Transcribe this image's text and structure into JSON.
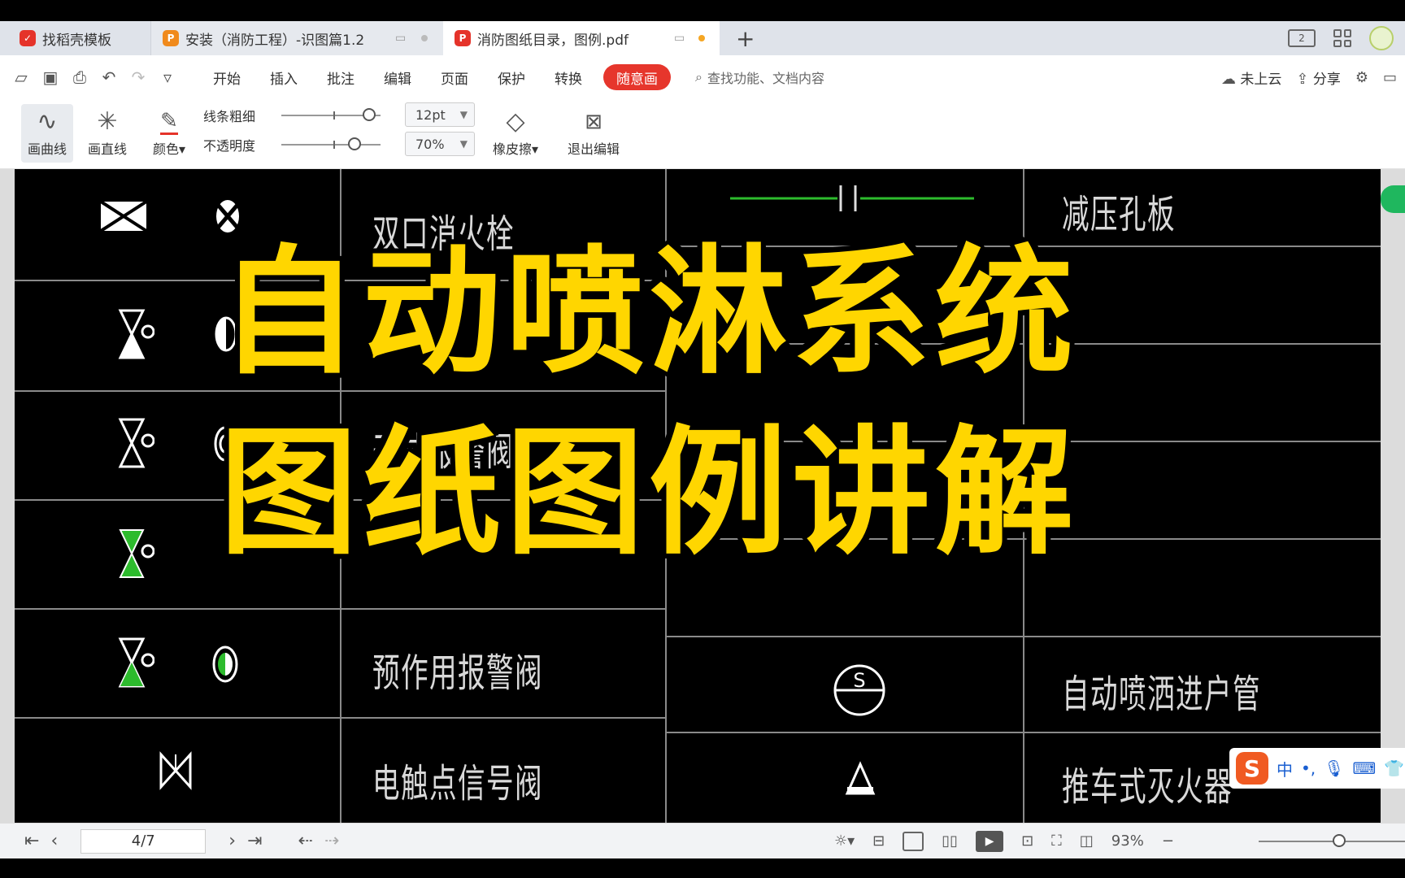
{
  "tabs": [
    {
      "label": "找稻壳模板",
      "icon": "docer-icon",
      "color": "#e5332a"
    },
    {
      "label": "安装（消防工程）-识图篇1.2",
      "icon": "ppt-icon",
      "color": "#f08a1c"
    },
    {
      "label": "消防图纸目录，图例.pdf",
      "icon": "pdf-icon",
      "color": "#e5332a"
    }
  ],
  "tabbar": {
    "window_btn": "2"
  },
  "menu": {
    "items": [
      "开始",
      "插入",
      "批注",
      "编辑",
      "页面",
      "保护",
      "转换"
    ],
    "active": "随意画",
    "search_placeholder": "查找功能、文档内容",
    "cloud": "未上云",
    "share": "分享"
  },
  "toolbar": {
    "curve": "画曲线",
    "line": "画直线",
    "color": "颜色",
    "thickness_label": "线条粗细",
    "thickness_value": "12pt",
    "opacity_label": "不透明度",
    "opacity_value": "70%",
    "eraser": "橡皮擦",
    "exit": "退出编辑"
  },
  "document": {
    "labels_left": [
      "双口消火栓",
      "干式报警阀",
      "预作用报警阀",
      "电触点信号阀"
    ],
    "labels_right": [
      "减压孔板",
      "自动喷洒进户管",
      "推车式灭火器"
    ],
    "circle_symbol_text": "S",
    "overlay_line1": "自动喷淋系统",
    "overlay_line2": "图纸图例讲解",
    "accent_color": "#ffd600"
  },
  "ime": {
    "lang": "中"
  },
  "statusbar": {
    "page": "4/7",
    "zoom": "93%",
    "zoom_fraction": 0.55
  }
}
